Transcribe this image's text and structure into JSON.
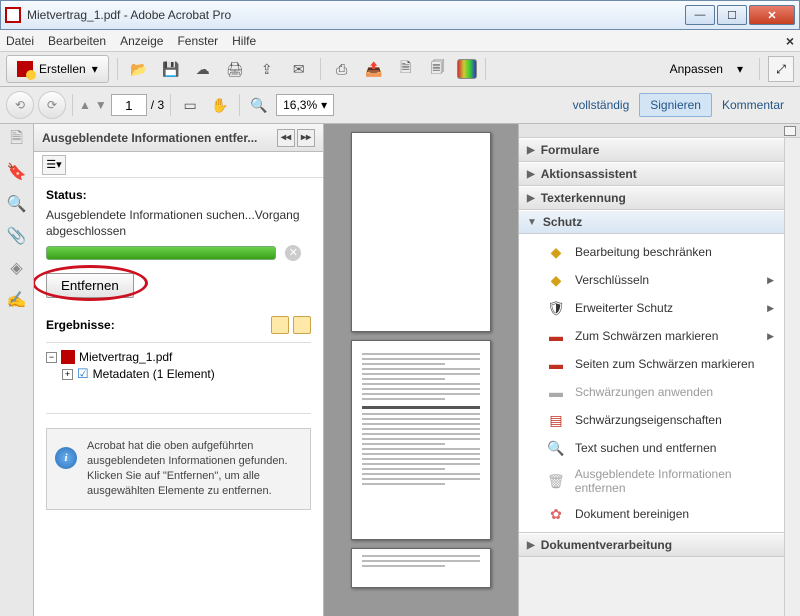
{
  "window": {
    "title": "Mietvertrag_1.pdf - Adobe Acrobat Pro"
  },
  "menu": {
    "datei": "Datei",
    "bearbeiten": "Bearbeiten",
    "anzeige": "Anzeige",
    "fenster": "Fenster",
    "hilfe": "Hilfe"
  },
  "toolbar": {
    "erstellen": "Erstellen",
    "anpassen": "Anpassen"
  },
  "nav": {
    "page": "1",
    "pages": "/  3",
    "zoom": "16,3%",
    "vollstaendig": "vollständig",
    "signieren": "Signieren",
    "kommentar": "Kommentar"
  },
  "panel": {
    "title": "Ausgeblendete Informationen entfer...",
    "status_label": "Status:",
    "status_text": "Ausgeblendete Informationen suchen...Vorgang abgeschlossen",
    "entfernen": "Entfernen",
    "ergebnisse": "Ergebnisse:",
    "tree_file": "Mietvertrag_1.pdf",
    "tree_meta": "Metadaten (1 Element)",
    "info": "Acrobat hat die oben aufgeführten ausgeblendeten Informationen gefunden. Klicken Sie auf \"Entfernen\", um alle ausgewählten Elemente zu entfernen."
  },
  "right": {
    "sections": {
      "formulare": "Formulare",
      "aktionsassistent": "Aktionsassistent",
      "texterkennung": "Texterkennung",
      "schutz": "Schutz",
      "dokumentverarbeitung": "Dokumentverarbeitung"
    },
    "schutz_items": {
      "beschraenken": "Bearbeitung beschränken",
      "verschluesseln": "Verschlüsseln",
      "erweitert": "Erweiterter Schutz",
      "zum_schwaerzen": "Zum Schwärzen markieren",
      "seiten_schwaerzen": "Seiten zum Schwärzen markieren",
      "anwenden": "Schwärzungen anwenden",
      "eigenschaften": "Schwärzungseigenschaften",
      "text_suchen": "Text suchen und entfernen",
      "ausgeblendete": "Ausgeblendete Informationen entfernen",
      "bereinigen": "Dokument bereinigen"
    }
  }
}
